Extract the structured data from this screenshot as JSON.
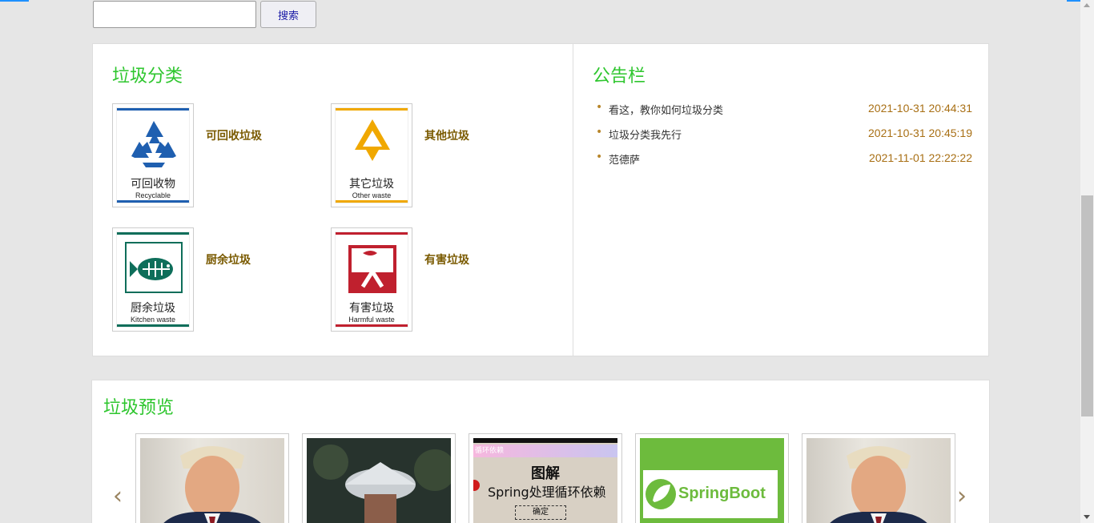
{
  "search": {
    "placeholder": "",
    "value": "",
    "button_label": "搜索"
  },
  "categories": {
    "title": "垃圾分类",
    "items": [
      {
        "label": "可回收垃圾",
        "sign_cn": "可回收物",
        "sign_en": "Recyclable",
        "color": "#1f5fb0"
      },
      {
        "label": "其他垃圾",
        "sign_cn": "其它垃圾",
        "sign_en": "Other waste",
        "color": "#f0a800"
      },
      {
        "label": "厨余垃圾",
        "sign_cn": "厨余垃圾",
        "sign_en": "Kitchen waste",
        "color": "#0e6e5a"
      },
      {
        "label": "有害垃圾",
        "sign_cn": "有害垃圾",
        "sign_en": "Harmful waste",
        "color": "#c0202e"
      }
    ]
  },
  "notice": {
    "title": "公告栏",
    "items": [
      {
        "title": "看这，教你如何垃圾分类",
        "date": "2021-10-31 20:44:31"
      },
      {
        "title": "垃圾分类我先行",
        "date": "2021-10-31 20:45:19"
      },
      {
        "title": "范德萨",
        "date": "2021-11-01 22:22:22"
      }
    ]
  },
  "preview": {
    "title": "垃圾预览",
    "prev_label": "‹",
    "next_label": "›",
    "items": [
      {
        "kind": "portrait"
      },
      {
        "kind": "building"
      },
      {
        "kind": "spring-diagram",
        "header": "循环依赖",
        "line1": "图解",
        "line2": "Spring处理循环依赖",
        "button": "确定"
      },
      {
        "kind": "springboot",
        "text": "SpringBoot"
      },
      {
        "kind": "portrait"
      }
    ]
  },
  "colors": {
    "accent_green": "#2ec62e",
    "label_brown": "#7a5a00",
    "date_brown": "#a86f14"
  }
}
